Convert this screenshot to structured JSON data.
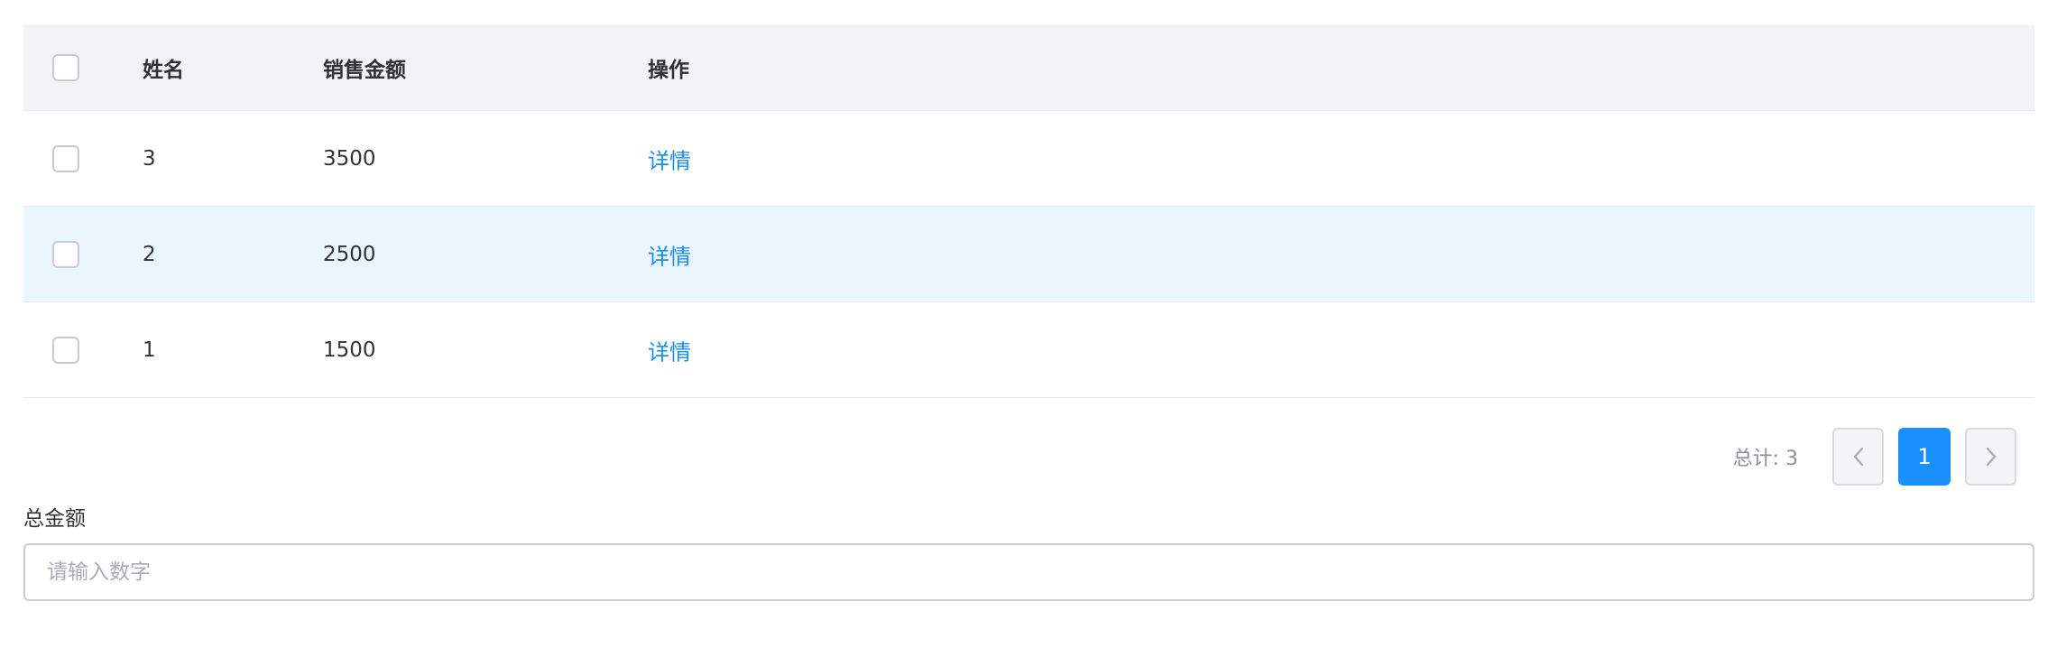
{
  "table": {
    "columns": {
      "name": "姓名",
      "amount": "销售金额",
      "action": "操作"
    },
    "rows": [
      {
        "name": "3",
        "amount": "3500",
        "action": "详情",
        "highlighted": false
      },
      {
        "name": "2",
        "amount": "2500",
        "action": "详情",
        "highlighted": true
      },
      {
        "name": "1",
        "amount": "1500",
        "action": "详情",
        "highlighted": false
      }
    ]
  },
  "pagination": {
    "total_label": "总计: 3",
    "current_page": "1",
    "prev_icon": "chevron-left-icon",
    "next_icon": "chevron-right-icon"
  },
  "form": {
    "total_amount_label": "总金额",
    "total_amount_placeholder": "请输入数字",
    "total_amount_value": ""
  },
  "colors": {
    "accent": "#1a8fff",
    "link": "#1a8fe8",
    "row_highlight": "#ebf5ff",
    "header_bg": "#f2f3f5"
  }
}
